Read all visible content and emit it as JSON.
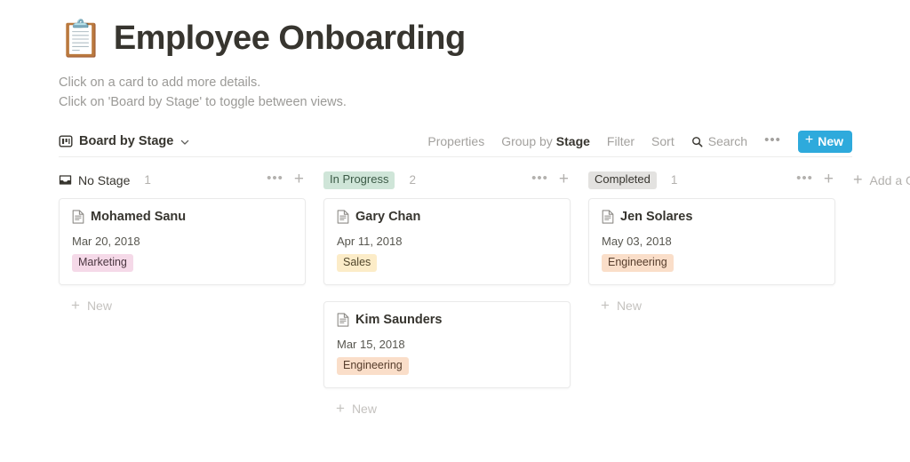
{
  "header": {
    "emoji": "📋",
    "title": "Employee Onboarding",
    "subtitle_line1": "Click on a card to add more details.",
    "subtitle_line2": "Click on 'Board by Stage' to toggle between views."
  },
  "toolbar": {
    "view_icon": "board-icon",
    "view_name": "Board by Stage",
    "chevron_icon": "chevron-down-icon",
    "properties_label": "Properties",
    "group_by_prefix": "Group by",
    "group_by_value": "Stage",
    "filter_label": "Filter",
    "sort_label": "Sort",
    "search_icon": "search-icon",
    "search_label": "Search",
    "more_label": "•••",
    "new_plus": "+",
    "new_label": "New",
    "new_button_color": "#2eaadc"
  },
  "board": {
    "add_group_plus": "+",
    "add_group_label": "Add a Group",
    "columns": [
      {
        "name": "No Stage",
        "style": "plain",
        "icon": "inbox-icon",
        "count": "1",
        "dots": "•••",
        "plus": "+",
        "new_plus": "+",
        "new_label": "New",
        "cards": [
          {
            "icon": "page-icon",
            "title": "Mohamed Sanu",
            "date": "Mar 20, 2018",
            "tag": "Marketing",
            "tag_color": "#f5d9e8",
            "tag_style": "tag-pink"
          }
        ]
      },
      {
        "name": "In Progress",
        "style": "pill-green",
        "pill_bg": "#cfe5d8",
        "count": "2",
        "dots": "•••",
        "plus": "+",
        "new_plus": "+",
        "new_label": "New",
        "cards": [
          {
            "icon": "page-icon",
            "title": "Gary Chan",
            "date": "Apr 11, 2018",
            "tag": "Sales",
            "tag_color": "#fcecc8",
            "tag_style": "tag-yellow"
          },
          {
            "icon": "page-icon",
            "title": "Kim Saunders",
            "date": "Mar 15, 2018",
            "tag": "Engineering",
            "tag_color": "#fadec9",
            "tag_style": "tag-orange"
          }
        ]
      },
      {
        "name": "Completed",
        "style": "pill-gray",
        "pill_bg": "#e3e2e0",
        "count": "1",
        "dots": "•••",
        "plus": "+",
        "new_plus": "+",
        "new_label": "New",
        "cards": [
          {
            "icon": "page-icon",
            "title": "Jen Solares",
            "date": "May 03, 2018",
            "tag": "Engineering",
            "tag_color": "#fadec9",
            "tag_style": "tag-orange"
          }
        ]
      }
    ]
  }
}
